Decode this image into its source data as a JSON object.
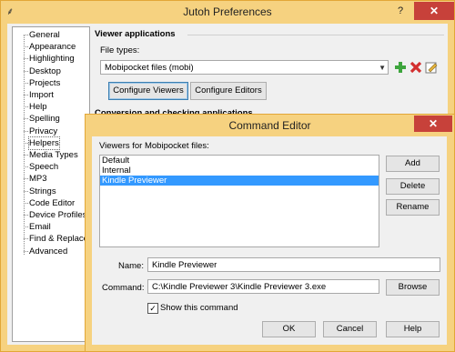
{
  "window": {
    "title": "Jutoh Preferences",
    "help_symbol": "?",
    "close_symbol": "✕"
  },
  "tree": {
    "items": [
      {
        "label": "General"
      },
      {
        "label": "Appearance"
      },
      {
        "label": "Highlighting"
      },
      {
        "label": "Desktop"
      },
      {
        "label": "Projects"
      },
      {
        "label": "Import"
      },
      {
        "label": "Help"
      },
      {
        "label": "Spelling"
      },
      {
        "label": "Privacy"
      },
      {
        "label": "Helpers",
        "selected": true
      },
      {
        "label": "Media Types"
      },
      {
        "label": "Speech"
      },
      {
        "label": "MP3"
      },
      {
        "label": "Strings"
      },
      {
        "label": "Code Editor"
      },
      {
        "label": "Device Profiles"
      },
      {
        "label": "Email"
      },
      {
        "label": "Find & Replace"
      },
      {
        "label": "Advanced"
      }
    ]
  },
  "viewer_section": {
    "heading": "Viewer applications",
    "file_types_label": "File types:",
    "file_types_value": "Mobipocket files (mobi)",
    "configure_viewers": "Configure Viewers",
    "configure_editors": "Configure Editors"
  },
  "conversion_section": {
    "heading": "Conversion and checking applications"
  },
  "command_editor": {
    "title": "Command Editor",
    "close_symbol": "✕",
    "viewers_label": "Viewers for Mobipocket files:",
    "viewers": [
      {
        "label": "Default"
      },
      {
        "label": "Internal"
      },
      {
        "label": "Kindle Previewer",
        "selected": true
      }
    ],
    "add": "Add",
    "delete": "Delete",
    "rename": "Rename",
    "name_label": "Name:",
    "name_value": "Kindle Previewer",
    "command_label": "Command:",
    "command_value": "C:\\Kindle Previewer 3\\Kindle Previewer 3.exe",
    "browse": "Browse",
    "show_command_label": "Show this command",
    "show_command_checked": true,
    "ok": "OK",
    "cancel": "Cancel",
    "help": "Help"
  }
}
